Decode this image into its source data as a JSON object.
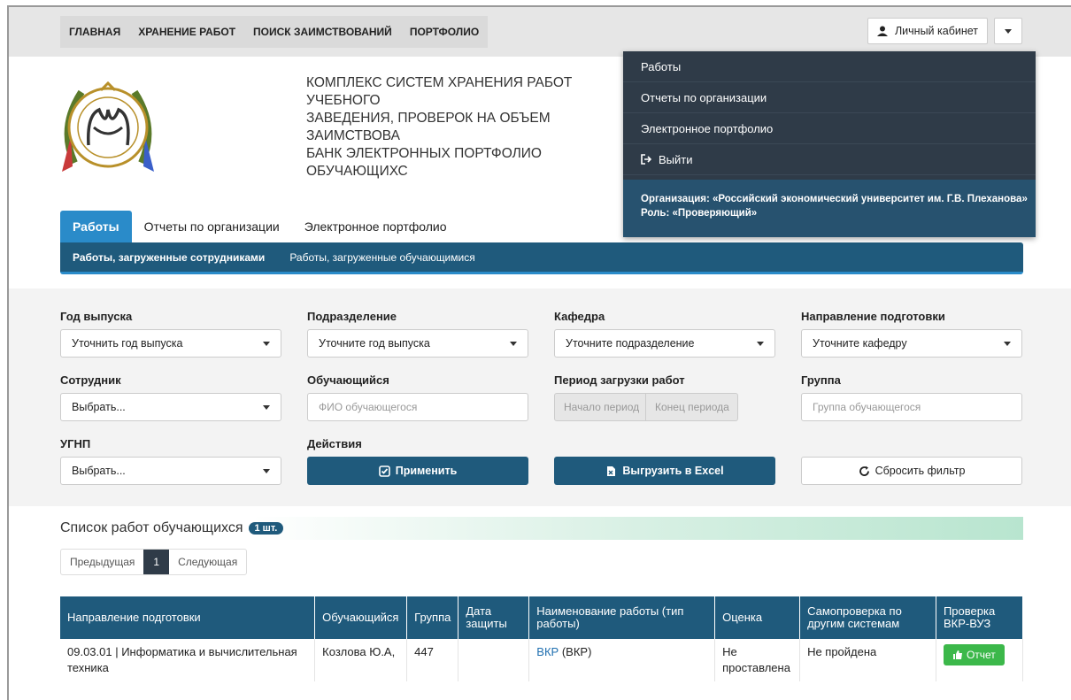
{
  "nav": {
    "tabs": [
      "ГЛАВНАЯ",
      "ХРАНЕНИЕ РАБОТ",
      "ПОИСК ЗАИМСТВОВАНИЙ",
      "ПОРТФОЛИО"
    ],
    "cabinet_label": "Личный кабинет"
  },
  "header": {
    "title": "КОМПЛЕКС СИСТЕМ ХРАНЕНИЯ РАБОТ УЧЕБНОГО\nЗАВЕДЕНИЯ, ПРОВЕРОК НА ОБЪЕМ ЗАИМСТВОВА\nБАНК ЭЛЕКТРОННЫХ ПОРТФОЛИО ОБУЧАЮЩИХС"
  },
  "dropdown": {
    "items": [
      "Работы",
      "Отчеты по организации",
      "Электронное портфолио"
    ],
    "logout": "Выйти",
    "organization": "Организация: «Российский экономический университет им. Г.В. Плеханова»",
    "role": "Роль: «Проверяющий»"
  },
  "tabs": [
    "Работы",
    "Отчеты по организации",
    "Электронное портфолио"
  ],
  "subtabs": [
    "Работы, загруженные сотрудниками",
    "Работы, загруженные обучающимися"
  ],
  "filters": {
    "year_label": "Год выпуска",
    "year_value": "Уточнить год выпуска",
    "division_label": "Подразделение",
    "division_value": "Уточните год выпуска",
    "dept_label": "Кафедра",
    "dept_value": "Уточните подразделение",
    "direction_label": "Направление подготовки",
    "direction_value": "Уточните кафедру",
    "employee_label": "Сотрудник",
    "employee_value": "Выбрать...",
    "student_label": "Обучающийся",
    "student_placeholder": "ФИО обучающегося",
    "period_label": "Период загрузки работ",
    "period_start": "Начало период",
    "period_end": "Конец периода",
    "group_label": "Группа",
    "group_placeholder": "Группа обучающегося",
    "ugnp_label": "УГНП",
    "ugnp_value": "Выбрать...",
    "actions_label": "Действия",
    "apply": "Применить",
    "excel": "Выгрузить в Excel",
    "reset": "Сбросить фильтр"
  },
  "list": {
    "title": "Список работ обучающихся",
    "count": "1 шт.",
    "prev": "Предыдущая",
    "page": "1",
    "next": "Следующая"
  },
  "table": {
    "headers": [
      "Направление подготовки",
      "Обучающийся",
      "Группа",
      "Дата защиты",
      "Наименование работы (тип работы)",
      "Оценка",
      "Самопроверка по другим системам",
      "Проверка ВКР-ВУЗ"
    ],
    "row": {
      "direction": "09.03.01 | Информатика и вычислительная техника",
      "student": "Козлова Ю.А,",
      "group": "447",
      "date": "",
      "work_link": "ВКР",
      "work_type": "(ВКР)",
      "grade": "Не проставлена",
      "selfcheck": "Не пройдена",
      "report": "Отчет"
    }
  },
  "colors": {
    "nav_dark": "#1f5a7c",
    "tab_active": "#2a8bc9",
    "dropdown": "#2f3b48",
    "success": "#3cb84a"
  }
}
